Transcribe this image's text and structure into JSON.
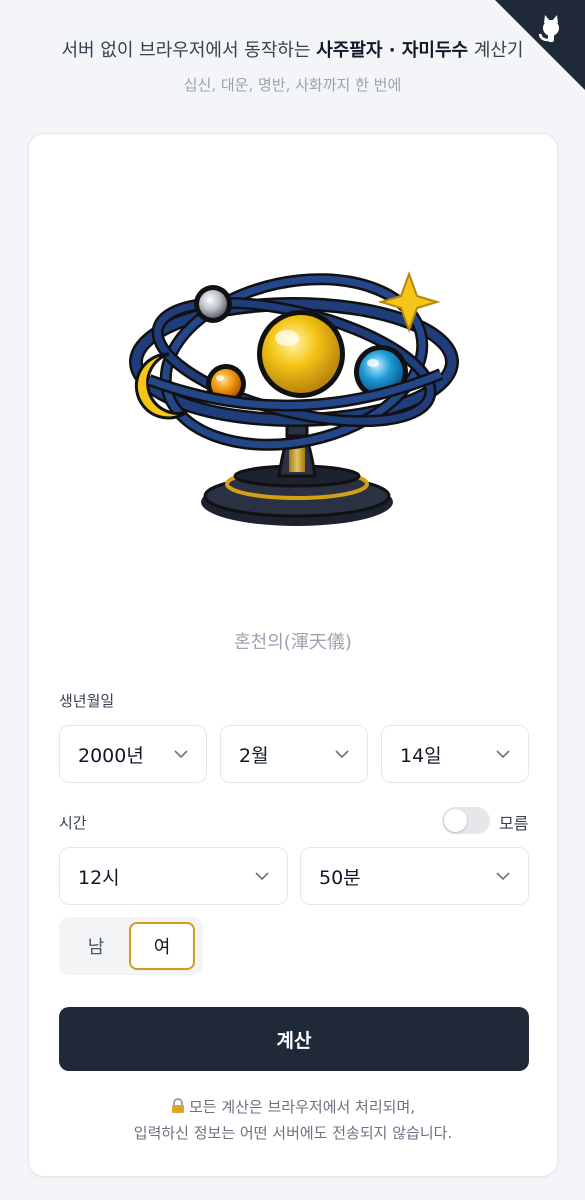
{
  "header": {
    "headline_prefix": "서버 없이 브라우저에서 동작하는 ",
    "headline_bold": "사주팔자 · 자미두수",
    "headline_suffix": " 계산기",
    "subline": "십신, 대운, 명반, 사화까지 한 번에"
  },
  "illustration": {
    "caption": "혼천의(渾天儀)"
  },
  "birth": {
    "label": "생년월일",
    "year": "2000년",
    "month": "2월",
    "day": "14일"
  },
  "time": {
    "label": "시간",
    "unknown_toggle_label": "모름",
    "unknown_toggle_on": false,
    "hour": "12시",
    "minute": "50분"
  },
  "gender": {
    "male": "남",
    "female": "여",
    "selected": "여"
  },
  "actions": {
    "calculate": "계산"
  },
  "notice": {
    "lock_icon": "lock-icon",
    "line1": "모든 계산은 브라우저에서 처리되며,",
    "line2": "입력하신 정보는 어떤 서버에도 전송되지 않습니다."
  },
  "colors": {
    "primary_button": "#1f2937",
    "selected_outline": "#d39b1c",
    "corner_badge": "#1f2937"
  }
}
